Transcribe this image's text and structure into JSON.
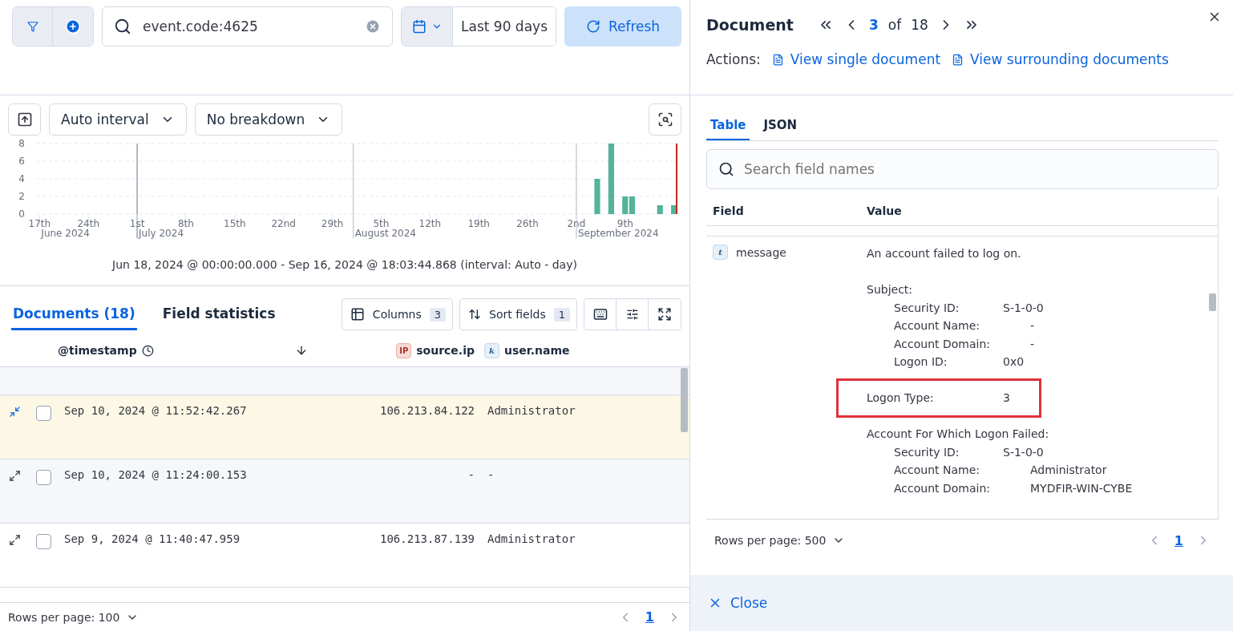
{
  "query_bar": {
    "query": "event.code:4625",
    "date_range": "Last 90 days",
    "refresh": "Refresh"
  },
  "chart_toolbar": {
    "interval": "Auto interval",
    "breakdown": "No breakdown"
  },
  "histogram": {
    "chart_data": {
      "type": "bar",
      "categories": [
        "17th",
        null,
        null,
        null,
        null,
        null,
        null,
        "24th",
        null,
        null,
        null,
        null,
        null,
        null,
        "1st",
        null,
        null,
        null,
        null,
        null,
        null,
        "8th",
        null,
        null,
        null,
        null,
        null,
        null,
        "15th",
        null,
        null,
        null,
        null,
        null,
        null,
        "22nd",
        null,
        null,
        null,
        null,
        null,
        null,
        "29th",
        null,
        null,
        null,
        null,
        null,
        null,
        "5th",
        null,
        null,
        null,
        null,
        null,
        null,
        "12th",
        null,
        null,
        null,
        null,
        null,
        null,
        "19th",
        null,
        null,
        null,
        null,
        null,
        null,
        "26th",
        null,
        null,
        null,
        null,
        null,
        null,
        "2nd",
        null,
        null,
        null,
        null,
        null,
        null,
        "9th",
        null,
        null,
        null,
        null,
        null,
        null,
        null
      ],
      "values": [
        0,
        0,
        0,
        0,
        0,
        0,
        0,
        0,
        0,
        0,
        0,
        0,
        0,
        0,
        0,
        0,
        0,
        0,
        0,
        0,
        0,
        0,
        0,
        0,
        0,
        0,
        0,
        0,
        0,
        0,
        0,
        0,
        0,
        0,
        0,
        0,
        0,
        0,
        0,
        0,
        0,
        0,
        0,
        0,
        0,
        0,
        0,
        0,
        0,
        0,
        0,
        0,
        0,
        0,
        0,
        0,
        0,
        0,
        0,
        0,
        0,
        0,
        0,
        0,
        0,
        0,
        0,
        0,
        0,
        0,
        0,
        0,
        0,
        0,
        0,
        0,
        0,
        0,
        0,
        0,
        4,
        0,
        8,
        0,
        2,
        2,
        0,
        0,
        0,
        1,
        0,
        1
      ],
      "ylim": [
        0,
        8
      ],
      "yticks": [
        0,
        2,
        4,
        6,
        8
      ],
      "grid": true,
      "annotations": [
        "June 2024",
        "July 2024",
        "August 2024",
        "September 2024"
      ]
    },
    "caption": "Jun 18, 2024 @ 00:00:00.000 - Sep 16, 2024 @ 18:03:44.868 (interval: Auto - day)"
  },
  "tabs": [
    {
      "label": "Documents (18)",
      "selected": true
    },
    {
      "label": "Field statistics",
      "selected": false
    }
  ],
  "grid_toolbar": {
    "columns": "Columns",
    "columns_count": "3",
    "sort": "Sort fields",
    "sort_count": "1"
  },
  "table": {
    "columns": [
      {
        "label": "@timestamp"
      },
      {
        "label": "source.ip",
        "type": "IP"
      },
      {
        "label": "user.name",
        "type": "k"
      }
    ],
    "rows": [
      {
        "timestamp": "Sep 10, 2024 @ 11:52:42.267",
        "source_ip": "106.213.84.122",
        "user_name": "Administrator",
        "expanded": true,
        "checked": false
      },
      {
        "timestamp": "Sep 10, 2024 @ 11:24:00.153",
        "source_ip": "-",
        "user_name": "-",
        "expanded": false,
        "checked": false
      },
      {
        "timestamp": "Sep 9, 2024 @ 11:40:47.959",
        "source_ip": "106.213.87.139",
        "user_name": "Administrator",
        "expanded": false,
        "checked": false
      }
    ],
    "rows_per_page": "Rows per page: 100",
    "page": "1"
  },
  "flyout": {
    "title": "Document",
    "index": "3",
    "of": "of",
    "total": "18",
    "actions_label": "Actions:",
    "actions": [
      "View single document",
      "View surrounding documents"
    ],
    "tabs": [
      {
        "label": "Table",
        "selected": true
      },
      {
        "label": "JSON",
        "selected": false
      }
    ],
    "search_placeholder": "Search field names",
    "columns": [
      "Field",
      "Value"
    ],
    "field": {
      "type": "t",
      "name": "message",
      "lines": [
        {
          "kind": "text",
          "text": "An account failed to log on.",
          "highlighted": false
        },
        {
          "kind": "blank"
        },
        {
          "kind": "text",
          "text": "Subject:",
          "highlighted": false
        },
        {
          "kind": "text",
          "text": "\tSecurity ID:\t\tS-1-0-0",
          "highlighted": false
        },
        {
          "kind": "text",
          "text": "\tAccount Name:\t\t-",
          "highlighted": false
        },
        {
          "kind": "text",
          "text": "\tAccount Domain:\t\t-",
          "highlighted": false
        },
        {
          "kind": "text",
          "text": "\tLogon ID:\t\t0x0",
          "highlighted": false
        },
        {
          "kind": "blank"
        },
        {
          "kind": "text",
          "text": "Logon Type:\t\t\t3",
          "highlighted": true
        },
        {
          "kind": "blank"
        },
        {
          "kind": "text",
          "text": "Account For Which Logon Failed:",
          "highlighted": false
        },
        {
          "kind": "text",
          "text": "\tSecurity ID:\t\tS-1-0-0",
          "highlighted": false
        },
        {
          "kind": "text",
          "text": "\tAccount Name:\t\tAdministrator",
          "highlighted": false
        },
        {
          "kind": "text",
          "text": "\tAccount Domain:\t\tMYDFIR-WIN-CYBE",
          "highlighted": false
        }
      ]
    },
    "rows_per_page": "Rows per page: 500",
    "page": "1",
    "close": "Close"
  }
}
